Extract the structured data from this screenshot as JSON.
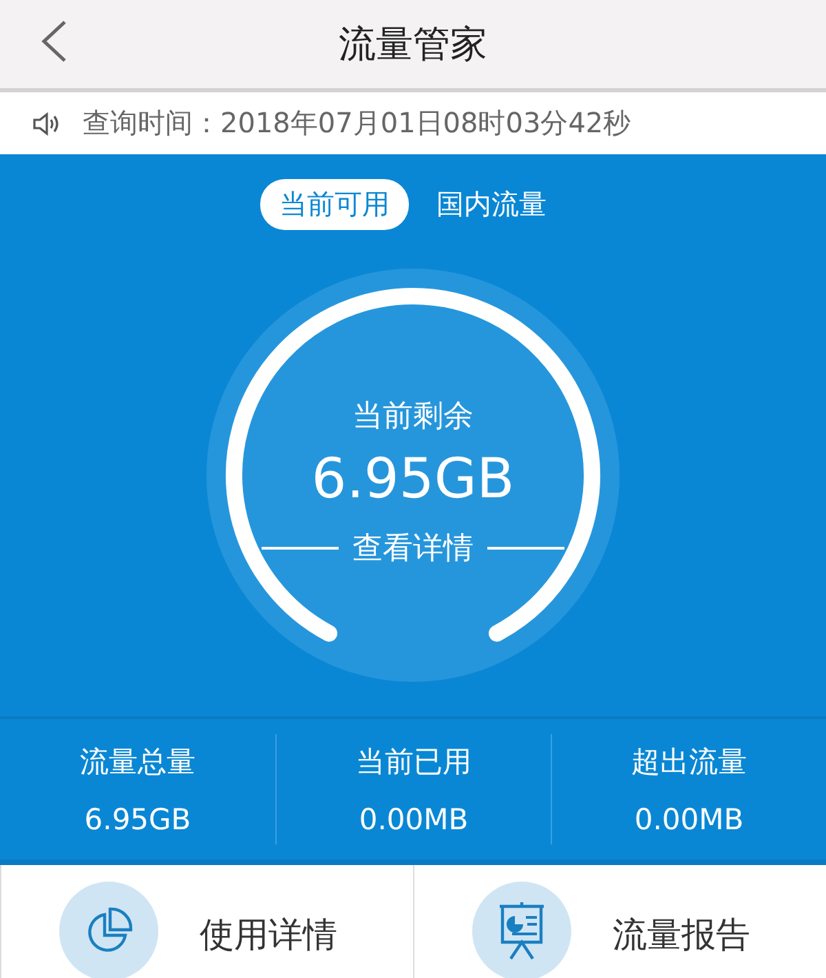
{
  "header": {
    "title": "流量管家"
  },
  "query": {
    "text": "查询时间：2018年07月01日08时03分42秒"
  },
  "tabs": [
    {
      "label": "当前可用",
      "selected": true
    },
    {
      "label": "国内流量",
      "selected": false
    }
  ],
  "gauge": {
    "label": "当前剩余",
    "value": "6.95GB",
    "link": "查看详情"
  },
  "stats": [
    {
      "label": "流量总量",
      "value": "6.95GB"
    },
    {
      "label": "当前已用",
      "value": "0.00MB"
    },
    {
      "label": "超出流量",
      "value": "0.00MB"
    }
  ],
  "actions": [
    {
      "label": "使用详情",
      "kind": "pie"
    },
    {
      "label": "流量报告",
      "kind": "report"
    }
  ]
}
